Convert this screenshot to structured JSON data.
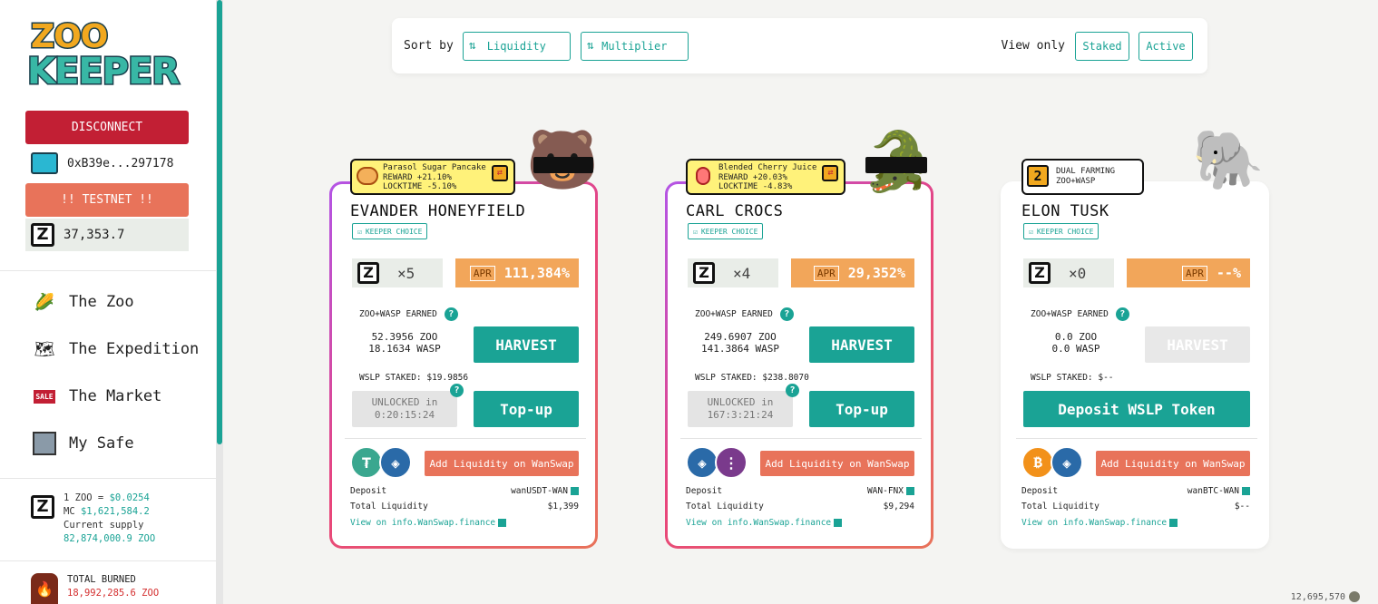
{
  "sidebar": {
    "logo_line1": "ZOO",
    "logo_line2": "KEEPER",
    "disconnect_label": "DISCONNECT",
    "wallet_address": "0xB39e...297178",
    "testnet_label": "!! TESTNET !!",
    "zoo_balance": "37,353.7",
    "nav": [
      {
        "label": "The Zoo",
        "icon": "zoo-icon"
      },
      {
        "label": "The Expedition",
        "icon": "expedition-icon"
      },
      {
        "label": "The Market",
        "icon": "market-sale-icon"
      },
      {
        "label": "My Safe",
        "icon": "safe-icon"
      }
    ],
    "stats": {
      "price_prefix": "1 ZOO = ",
      "price": "$0.0254",
      "mc_prefix": "MC ",
      "mc": "$1,621,584.2",
      "supply_label": "Current supply",
      "supply": "82,874,000.9 ZOO"
    },
    "burned": {
      "label": "TOTAL BURNED",
      "value": "18,992,285.6 ZOO"
    }
  },
  "sortbar": {
    "sort_label": "Sort by",
    "liquidity_label": "Liquidity",
    "multiplier_label": "Multiplier",
    "view_label": "View only",
    "staked_label": "Staked",
    "active_label": "Active"
  },
  "cards": [
    {
      "tag_line1": "Parasol Sugar Pancake",
      "tag_line2": "REWARD +21.10%",
      "tag_line3": "LOCKTIME -5.10%",
      "title": "EVANDER HONEYFIELD",
      "badge": "KEEPER CHOICE",
      "multiplier": "×5",
      "apr": "111,384%",
      "earned_label": "ZOO+WASP EARNED",
      "zoo_earned": "52.3956 ZOO",
      "wasp_earned": "18.1634 WASP",
      "harvest_label": "HARVEST",
      "staked_label": "WSLP STAKED: $19.9856",
      "unlock_line1": "UNLOCKED in",
      "unlock_line2": "0:20:15:24",
      "topup_label": "Top-up",
      "addliq_label": "Add Liquidity on WanSwap",
      "deposit_label": "Deposit",
      "deposit_value": "wanUSDT-WAN",
      "liquidity_label": "Total Liquidity",
      "liquidity_value": "$1,399",
      "info_link": "View on info.WanSwap.finance"
    },
    {
      "tag_line1": "Blended Cherry Juice",
      "tag_line2": "REWARD +20.03%",
      "tag_line3": "LOCKTIME -4.83%",
      "title": "CARL CROCS",
      "badge": "KEEPER CHOICE",
      "multiplier": "×4",
      "apr": "29,352%",
      "earned_label": "ZOO+WASP EARNED",
      "zoo_earned": "249.6907 ZOO",
      "wasp_earned": "141.3864 WASP",
      "harvest_label": "HARVEST",
      "staked_label": "WSLP STAKED: $238.8070",
      "unlock_line1": "UNLOCKED in",
      "unlock_line2": "167:3:21:24",
      "topup_label": "Top-up",
      "addliq_label": "Add Liquidity on WanSwap",
      "deposit_label": "Deposit",
      "deposit_value": "WAN-FNX",
      "liquidity_label": "Total Liquidity",
      "liquidity_value": "$9,294",
      "info_link": "View on info.WanSwap.finance"
    },
    {
      "tag_icon": "2",
      "tag_line1": "DUAL FARMING",
      "tag_line2": "ZOO+WASP",
      "title": "ELON TUSK",
      "badge": "KEEPER CHOICE",
      "multiplier": "×0",
      "apr": "--%",
      "earned_label": "ZOO+WASP EARNED",
      "zoo_earned": "0.0 ZOO",
      "wasp_earned": "0.0 WASP",
      "harvest_label": "HARVEST",
      "staked_label": "WSLP STAKED: $--",
      "deposit_btn_label": "Deposit WSLP Token",
      "addliq_label": "Add Liquidity on WanSwap",
      "deposit_label": "Deposit",
      "deposit_value": "wanBTC-WAN",
      "liquidity_label": "Total Liquidity",
      "liquidity_value": "$--",
      "info_link": "View on info.WanSwap.finance"
    }
  ],
  "footer_value": "12,695,570",
  "apr_icon_text": "APR",
  "colors": {
    "teal": "#1aa395",
    "disconnect": "#c21f34",
    "testnet": "#e8735a",
    "apr": "#f2a65a"
  }
}
